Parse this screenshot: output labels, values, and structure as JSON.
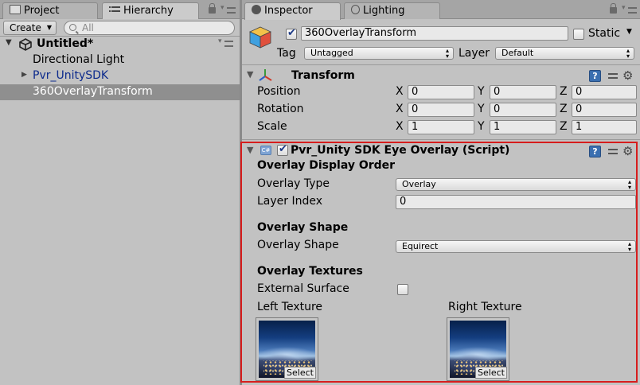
{
  "left_panel": {
    "tabs": [
      {
        "label": "Project",
        "icon": "folder-icon"
      },
      {
        "label": "Hierarchy",
        "icon": "list-icon"
      }
    ],
    "create_label": "Create",
    "search_placeholder": "All",
    "scene_title": "Untitled*",
    "items": [
      {
        "label": "Directional Light"
      },
      {
        "label": "Pvr_UnitySDK"
      },
      {
        "label": "360OverlayTransform"
      }
    ]
  },
  "inspector": {
    "tabs": [
      {
        "label": "Inspector",
        "icon": "info-icon"
      },
      {
        "label": "Lighting",
        "icon": "lightbulb-icon"
      }
    ],
    "object": {
      "active": true,
      "name": "360OverlayTransform",
      "static_label": "Static",
      "static_checked": false,
      "tag_label": "Tag",
      "tag_value": "Untagged",
      "layer_label": "Layer",
      "layer_value": "Default"
    },
    "transform": {
      "title": "Transform",
      "rows": [
        {
          "label": "Position",
          "x": "0",
          "y": "0",
          "z": "0"
        },
        {
          "label": "Rotation",
          "x": "0",
          "y": "0",
          "z": "0"
        },
        {
          "label": "Scale",
          "x": "1",
          "y": "1",
          "z": "1"
        }
      ],
      "axis_x": "X",
      "axis_y": "Y",
      "axis_z": "Z"
    },
    "overlay_script": {
      "title": "Pvr_Unity SDK Eye Overlay (Script)",
      "enabled": true,
      "display_order_header": "Overlay Display Order",
      "overlay_type_label": "Overlay Type",
      "overlay_type_value": "Overlay",
      "layer_index_label": "Layer Index",
      "layer_index_value": "0",
      "shape_header": "Overlay Shape",
      "shape_label": "Overlay Shape",
      "shape_value": "Equirect",
      "textures_header": "Overlay Textures",
      "external_surface_label": "External Surface",
      "external_surface_checked": false,
      "left_texture_label": "Left Texture",
      "right_texture_label": "Right Texture",
      "select_label": "Select"
    }
  },
  "colors": {
    "highlight_box": "#d71d1d",
    "selected_row": "#8f8f8f",
    "prefab_text": "#0c2a8c"
  }
}
